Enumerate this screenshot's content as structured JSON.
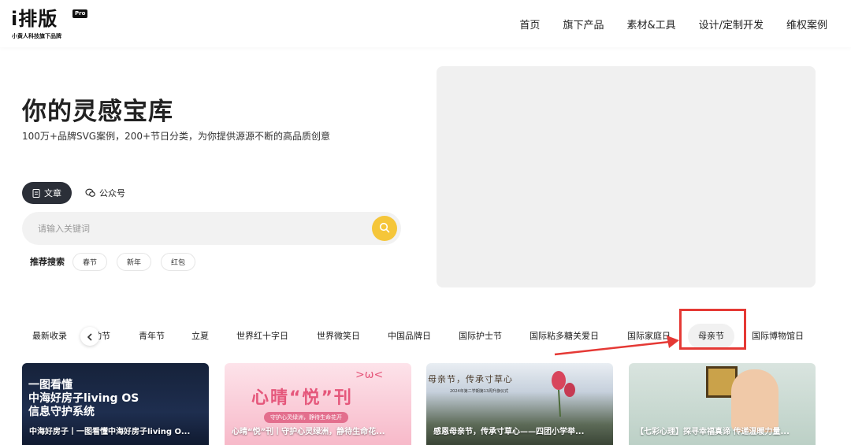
{
  "header": {
    "logo_text": "i排版",
    "logo_badge": "Pro",
    "logo_tagline": "小黄人科技旗下品牌",
    "nav": [
      "首页",
      "旗下产品",
      "素材&工具",
      "设计/定制开发",
      "维权案例"
    ]
  },
  "hero": {
    "title": "你的灵感宝库",
    "subtitle": "100万+品牌SVG案例，200+节日分类，为你提供源源不断的高品质创意"
  },
  "tabs": {
    "article": "文章",
    "official_account": "公众号"
  },
  "search": {
    "placeholder": "请输入关键词"
  },
  "hot_search": {
    "label": "推荐搜索",
    "tags": [
      "春节",
      "新年",
      "红包"
    ]
  },
  "categories": {
    "latest": "最新收录",
    "items": [
      "动节",
      "青年节",
      "立夏",
      "世界红十字日",
      "世界微笑日",
      "中国品牌日",
      "国际护士节",
      "国际粘多糖关爱日",
      "国际家庭日",
      "母亲节",
      "国际博物馆日"
    ],
    "selected": "母亲节"
  },
  "cards": [
    {
      "image_text": "一图看懂\n中海好房子living OS\n信息守护系统",
      "caption": "中海好房子丨一图看懂中海好房子living O..."
    },
    {
      "image_title": "心晴“悦”刊",
      "image_sub": "守护心灵绿洲，静待生命花开",
      "caption": "心晴“悦”刊丨守护心灵绿洲，静待生命花..."
    },
    {
      "image_title": "母亲节，传承寸草心",
      "image_sub": "2024年第二学期第13周升旗仪式",
      "caption": "感恩母亲节，传承寸草心——四团小学举..."
    },
    {
      "caption": "【七彩心理】探寻幸福真谛 传递温暖力量..."
    }
  ],
  "colors": {
    "accent": "#f5c63a",
    "dark": "#2b2f38",
    "highlight": "#e53935"
  }
}
